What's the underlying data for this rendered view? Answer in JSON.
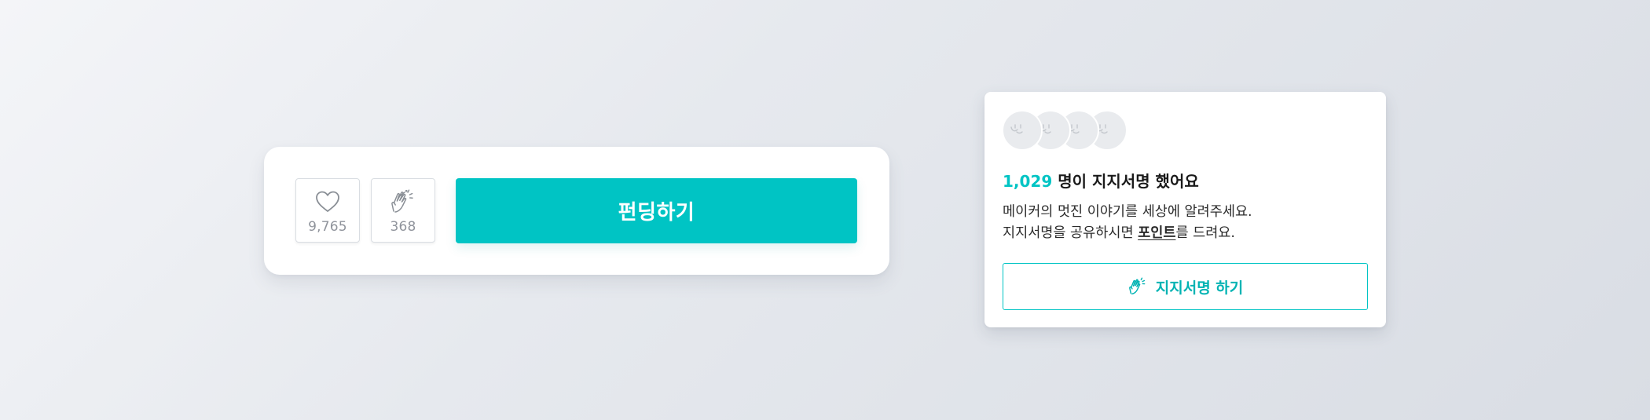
{
  "funding_card": {
    "like": {
      "icon": "heart-icon",
      "count": "9,765"
    },
    "cheer": {
      "icon": "clapping-hands-icon",
      "count": "368"
    },
    "fund_button_label": "펀딩하기",
    "accent_color": "#00c4c4"
  },
  "support_card": {
    "avatars": [
      {
        "icon": "smiley-avatar-icon"
      },
      {
        "icon": "smiley-avatar-icon"
      },
      {
        "icon": "smiley-avatar-icon"
      },
      {
        "icon": "smiley-avatar-icon"
      }
    ],
    "count_number": "1,029",
    "count_suffix": " 명이 지지서명 했어요",
    "desc_line1": "메이커의 멋진 이야기를 세상에 알려주세요.",
    "desc_line2_prefix": "지지서명을 공유하시면 ",
    "desc_line2_point": "포인트",
    "desc_line2_suffix": "를 드려요.",
    "button_icon": "clapping-hands-icon",
    "button_label": "지지서명 하기",
    "accent_color": "#00c4c4"
  }
}
